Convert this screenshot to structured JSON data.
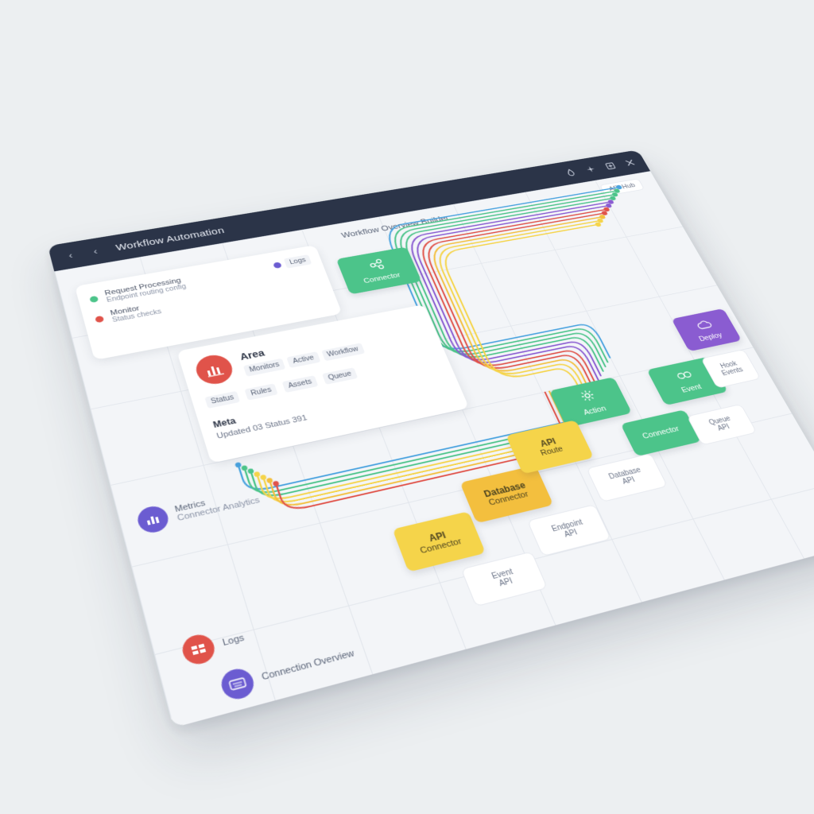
{
  "app": {
    "title": "Workflow Automation",
    "canvas_title": "Workflow Overview Builder",
    "api_chip": "API Hub"
  },
  "titlebar": {
    "back": "‹",
    "forward": "‹",
    "icons": [
      "drop-icon",
      "sparkle-icon",
      "export-icon",
      "close-icon"
    ]
  },
  "panel_a": {
    "rows": [
      {
        "label": "Request Processing",
        "sub": "Endpoint routing config"
      },
      {
        "label": "Monitor",
        "sub": "Status checks"
      }
    ],
    "corner_tag": "Logs"
  },
  "panel_b": {
    "title": "Area",
    "subtitle": "Meta",
    "meta": "Updated 03 Status 391",
    "tags": [
      "Monitors",
      "Active",
      "Workflow"
    ],
    "counters": [
      "Status",
      "Rules",
      "Assets",
      "Queue"
    ]
  },
  "nodes": {
    "trigger": "Connector",
    "green_1": "Action",
    "green_2": "Connector",
    "green_3": "Event",
    "purple_1": "Deploy",
    "yellow_1": "API",
    "yellow_1_sub": "Connector",
    "orange_1": "Database",
    "orange_1_sub": "Connector",
    "yellow_2": "API",
    "yellow_2_sub": "Route"
  },
  "ghosts": [
    {
      "title": "Event",
      "sub": "API"
    },
    {
      "title": "Endpoint",
      "sub": "API"
    },
    {
      "title": "Database",
      "sub": "API"
    },
    {
      "title": "Queue",
      "sub": "API"
    },
    {
      "title": "Hook",
      "sub": "Events"
    }
  ],
  "sidebar": [
    {
      "label": "Metrics"
    },
    {
      "label": "Connector Analytics"
    },
    {
      "label": "Logs"
    },
    {
      "label": "Connection Overview"
    }
  ],
  "colors": {
    "titlebar": "#2b3448",
    "green": "#4cc48a",
    "yellow": "#f5d44a",
    "orange": "#f3bf3e",
    "purple": "#8a5cd1",
    "red": "#e0534a",
    "blue": "#4aa3df"
  }
}
